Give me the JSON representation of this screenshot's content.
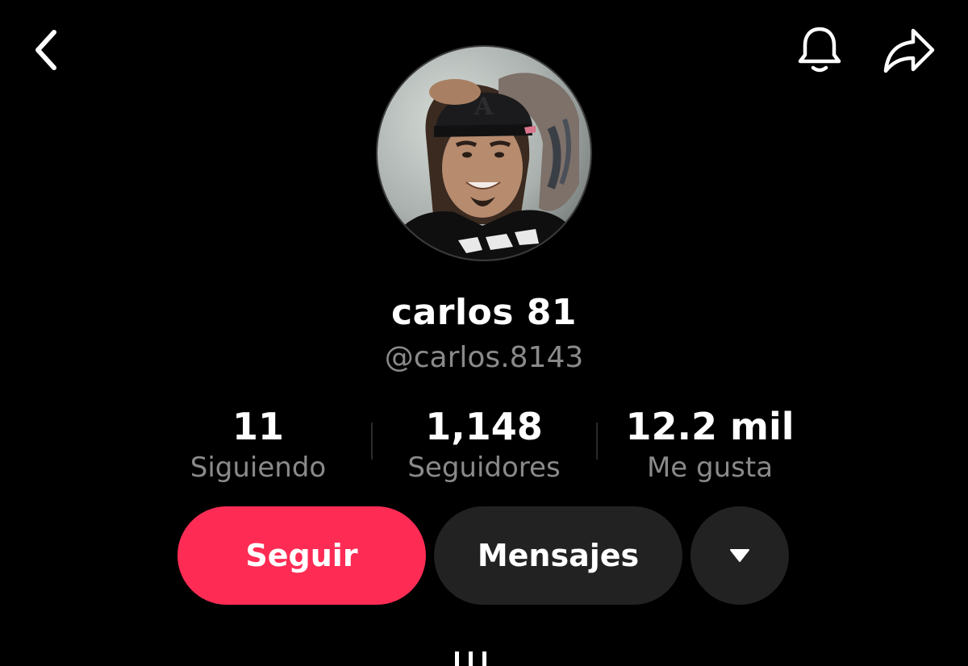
{
  "header": {
    "back_icon": "chevron-left-icon",
    "notification_icon": "bell-icon",
    "share_icon": "share-arrow-icon"
  },
  "profile": {
    "display_name": "carlos 81",
    "handle": "@carlos.8143",
    "avatar_icon": "profile-photo"
  },
  "stats": [
    {
      "value": "11",
      "label": "Siguiendo"
    },
    {
      "value": "1,148",
      "label": "Seguidores"
    },
    {
      "value": "12.2 mil",
      "label": "Me gusta"
    }
  ],
  "actions": {
    "follow_label": "Seguir",
    "message_label": "Mensajes",
    "more_icon": "triangle-down-icon"
  },
  "tabs": {
    "grid_icon": "grid-tab-icon"
  },
  "colors": {
    "background": "#000000",
    "accent": "#fe2c55",
    "secondary_button": "#222222",
    "muted_text": "#8a8a8a"
  }
}
